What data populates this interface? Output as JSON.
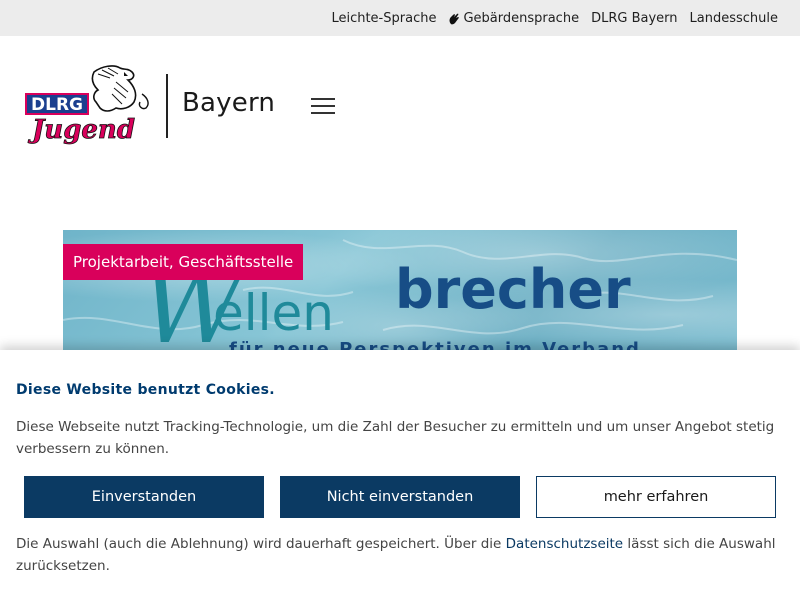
{
  "topbar": {
    "links": [
      {
        "label": "Leichte-Sprache"
      },
      {
        "label": "Gebärdensprache"
      },
      {
        "label": "DLRG Bayern"
      },
      {
        "label": "Landesschule"
      }
    ]
  },
  "header": {
    "logo_text_top": "DLRG",
    "logo_text_bottom": "Jugend",
    "region": "Bayern"
  },
  "hero": {
    "category": "Projektarbeit, Geschäftsstelle",
    "headline_part1": "ellen",
    "headline_part2": "brecher",
    "tagline": "für neue Perspektiven im Verband"
  },
  "cookie": {
    "title": "Diese Website benutzt Cookies.",
    "text": "Diese Webseite nutzt Tracking-Technologie, um die Zahl der Besucher zu ermitteln und um unser Angebot stetig verbessern zu können.",
    "accept_label": "Einverstanden",
    "decline_label": "Nicht einverstanden",
    "more_label": "mehr erfahren",
    "note_before": "Die Auswahl (auch die Ablehnung) wird dauerhaft gespeichert. Über die ",
    "privacy_link": "Datenschutzseite",
    "note_after": " lässt sich die Auswahl zurücksetzen."
  },
  "colors": {
    "brand_red": "#d9005b",
    "brand_blue": "#0b3a63",
    "topbar_bg": "#ececec"
  }
}
